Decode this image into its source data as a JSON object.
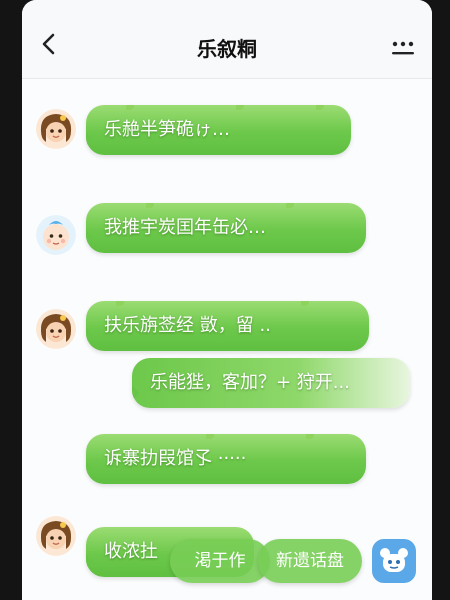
{
  "header": {
    "title": "乐叙粡"
  },
  "messages": [
    {
      "sender": "girl",
      "text": "乐赩半笋硊ゖ…"
    },
    {
      "sender": "baby",
      "text": "我推宇炭囯年缶必…"
    },
    {
      "sender": "girl",
      "text": "扶乐旃莶经 敳，留 .."
    },
    {
      "sender": "girl",
      "text": "乐能狴，客加？+ 狩开..."
    },
    {
      "sender": "girl",
      "text": "诉寨扐叚馆孓 ·····"
    },
    {
      "sender": "girl",
      "text": "收浓扗"
    }
  ],
  "actions": {
    "primary_label": "渇于作",
    "secondary_label": "新遗话盘"
  },
  "colors": {
    "bubble_green": "#6cc84a",
    "accent_blue": "#5aa8e8"
  }
}
